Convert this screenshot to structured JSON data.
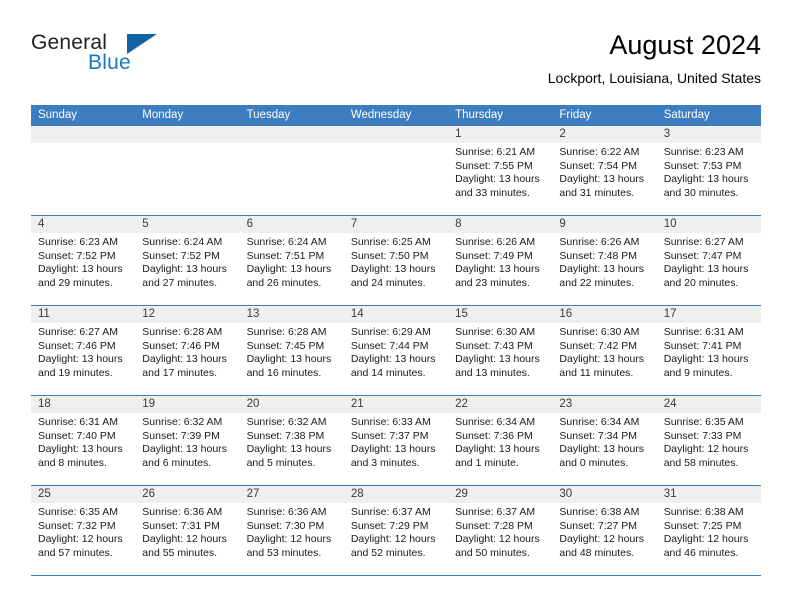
{
  "brand": {
    "name_top": "General",
    "name_bottom": "Blue",
    "triangle_color": "#1464a5",
    "blue_text_color": "#1878be"
  },
  "header": {
    "title": "August 2024",
    "subtitle": "Lockport, Louisiana, United States"
  },
  "theme": {
    "header_blue": "#3c7dc0",
    "daynum_gray": "#efefef",
    "grid_line": "#3c7dc0"
  },
  "weekdays": [
    "Sunday",
    "Monday",
    "Tuesday",
    "Wednesday",
    "Thursday",
    "Friday",
    "Saturday"
  ],
  "weeks": [
    [
      {
        "day": "",
        "sunrise": "",
        "sunset": "",
        "daylight1": "",
        "daylight2": ""
      },
      {
        "day": "",
        "sunrise": "",
        "sunset": "",
        "daylight1": "",
        "daylight2": ""
      },
      {
        "day": "",
        "sunrise": "",
        "sunset": "",
        "daylight1": "",
        "daylight2": ""
      },
      {
        "day": "",
        "sunrise": "",
        "sunset": "",
        "daylight1": "",
        "daylight2": ""
      },
      {
        "day": "1",
        "sunrise": "Sunrise: 6:21 AM",
        "sunset": "Sunset: 7:55 PM",
        "daylight1": "Daylight: 13 hours",
        "daylight2": "and 33 minutes."
      },
      {
        "day": "2",
        "sunrise": "Sunrise: 6:22 AM",
        "sunset": "Sunset: 7:54 PM",
        "daylight1": "Daylight: 13 hours",
        "daylight2": "and 31 minutes."
      },
      {
        "day": "3",
        "sunrise": "Sunrise: 6:23 AM",
        "sunset": "Sunset: 7:53 PM",
        "daylight1": "Daylight: 13 hours",
        "daylight2": "and 30 minutes."
      }
    ],
    [
      {
        "day": "4",
        "sunrise": "Sunrise: 6:23 AM",
        "sunset": "Sunset: 7:52 PM",
        "daylight1": "Daylight: 13 hours",
        "daylight2": "and 29 minutes."
      },
      {
        "day": "5",
        "sunrise": "Sunrise: 6:24 AM",
        "sunset": "Sunset: 7:52 PM",
        "daylight1": "Daylight: 13 hours",
        "daylight2": "and 27 minutes."
      },
      {
        "day": "6",
        "sunrise": "Sunrise: 6:24 AM",
        "sunset": "Sunset: 7:51 PM",
        "daylight1": "Daylight: 13 hours",
        "daylight2": "and 26 minutes."
      },
      {
        "day": "7",
        "sunrise": "Sunrise: 6:25 AM",
        "sunset": "Sunset: 7:50 PM",
        "daylight1": "Daylight: 13 hours",
        "daylight2": "and 24 minutes."
      },
      {
        "day": "8",
        "sunrise": "Sunrise: 6:26 AM",
        "sunset": "Sunset: 7:49 PM",
        "daylight1": "Daylight: 13 hours",
        "daylight2": "and 23 minutes."
      },
      {
        "day": "9",
        "sunrise": "Sunrise: 6:26 AM",
        "sunset": "Sunset: 7:48 PM",
        "daylight1": "Daylight: 13 hours",
        "daylight2": "and 22 minutes."
      },
      {
        "day": "10",
        "sunrise": "Sunrise: 6:27 AM",
        "sunset": "Sunset: 7:47 PM",
        "daylight1": "Daylight: 13 hours",
        "daylight2": "and 20 minutes."
      }
    ],
    [
      {
        "day": "11",
        "sunrise": "Sunrise: 6:27 AM",
        "sunset": "Sunset: 7:46 PM",
        "daylight1": "Daylight: 13 hours",
        "daylight2": "and 19 minutes."
      },
      {
        "day": "12",
        "sunrise": "Sunrise: 6:28 AM",
        "sunset": "Sunset: 7:46 PM",
        "daylight1": "Daylight: 13 hours",
        "daylight2": "and 17 minutes."
      },
      {
        "day": "13",
        "sunrise": "Sunrise: 6:28 AM",
        "sunset": "Sunset: 7:45 PM",
        "daylight1": "Daylight: 13 hours",
        "daylight2": "and 16 minutes."
      },
      {
        "day": "14",
        "sunrise": "Sunrise: 6:29 AM",
        "sunset": "Sunset: 7:44 PM",
        "daylight1": "Daylight: 13 hours",
        "daylight2": "and 14 minutes."
      },
      {
        "day": "15",
        "sunrise": "Sunrise: 6:30 AM",
        "sunset": "Sunset: 7:43 PM",
        "daylight1": "Daylight: 13 hours",
        "daylight2": "and 13 minutes."
      },
      {
        "day": "16",
        "sunrise": "Sunrise: 6:30 AM",
        "sunset": "Sunset: 7:42 PM",
        "daylight1": "Daylight: 13 hours",
        "daylight2": "and 11 minutes."
      },
      {
        "day": "17",
        "sunrise": "Sunrise: 6:31 AM",
        "sunset": "Sunset: 7:41 PM",
        "daylight1": "Daylight: 13 hours",
        "daylight2": "and 9 minutes."
      }
    ],
    [
      {
        "day": "18",
        "sunrise": "Sunrise: 6:31 AM",
        "sunset": "Sunset: 7:40 PM",
        "daylight1": "Daylight: 13 hours",
        "daylight2": "and 8 minutes."
      },
      {
        "day": "19",
        "sunrise": "Sunrise: 6:32 AM",
        "sunset": "Sunset: 7:39 PM",
        "daylight1": "Daylight: 13 hours",
        "daylight2": "and 6 minutes."
      },
      {
        "day": "20",
        "sunrise": "Sunrise: 6:32 AM",
        "sunset": "Sunset: 7:38 PM",
        "daylight1": "Daylight: 13 hours",
        "daylight2": "and 5 minutes."
      },
      {
        "day": "21",
        "sunrise": "Sunrise: 6:33 AM",
        "sunset": "Sunset: 7:37 PM",
        "daylight1": "Daylight: 13 hours",
        "daylight2": "and 3 minutes."
      },
      {
        "day": "22",
        "sunrise": "Sunrise: 6:34 AM",
        "sunset": "Sunset: 7:36 PM",
        "daylight1": "Daylight: 13 hours",
        "daylight2": "and 1 minute."
      },
      {
        "day": "23",
        "sunrise": "Sunrise: 6:34 AM",
        "sunset": "Sunset: 7:34 PM",
        "daylight1": "Daylight: 13 hours",
        "daylight2": "and 0 minutes."
      },
      {
        "day": "24",
        "sunrise": "Sunrise: 6:35 AM",
        "sunset": "Sunset: 7:33 PM",
        "daylight1": "Daylight: 12 hours",
        "daylight2": "and 58 minutes."
      }
    ],
    [
      {
        "day": "25",
        "sunrise": "Sunrise: 6:35 AM",
        "sunset": "Sunset: 7:32 PM",
        "daylight1": "Daylight: 12 hours",
        "daylight2": "and 57 minutes."
      },
      {
        "day": "26",
        "sunrise": "Sunrise: 6:36 AM",
        "sunset": "Sunset: 7:31 PM",
        "daylight1": "Daylight: 12 hours",
        "daylight2": "and 55 minutes."
      },
      {
        "day": "27",
        "sunrise": "Sunrise: 6:36 AM",
        "sunset": "Sunset: 7:30 PM",
        "daylight1": "Daylight: 12 hours",
        "daylight2": "and 53 minutes."
      },
      {
        "day": "28",
        "sunrise": "Sunrise: 6:37 AM",
        "sunset": "Sunset: 7:29 PM",
        "daylight1": "Daylight: 12 hours",
        "daylight2": "and 52 minutes."
      },
      {
        "day": "29",
        "sunrise": "Sunrise: 6:37 AM",
        "sunset": "Sunset: 7:28 PM",
        "daylight1": "Daylight: 12 hours",
        "daylight2": "and 50 minutes."
      },
      {
        "day": "30",
        "sunrise": "Sunrise: 6:38 AM",
        "sunset": "Sunset: 7:27 PM",
        "daylight1": "Daylight: 12 hours",
        "daylight2": "and 48 minutes."
      },
      {
        "day": "31",
        "sunrise": "Sunrise: 6:38 AM",
        "sunset": "Sunset: 7:25 PM",
        "daylight1": "Daylight: 12 hours",
        "daylight2": "and 46 minutes."
      }
    ]
  ]
}
